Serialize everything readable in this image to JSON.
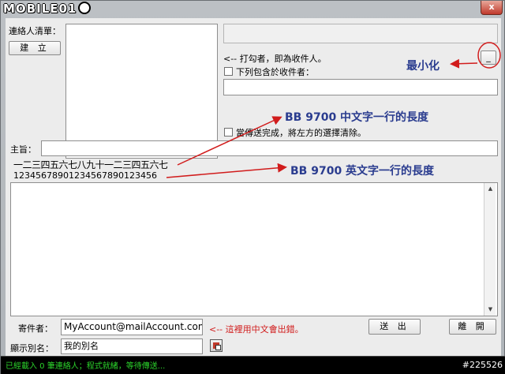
{
  "window": {
    "logo_text": "MOBILE01",
    "close_glyph": "x"
  },
  "contacts": {
    "label": "連絡人清單：",
    "create_button": "建 立"
  },
  "recipients": {
    "hint": "<-- 打勾者，即為收件人。",
    "include_label": "下列包含於收件者：",
    "minimize_button": "_",
    "clear_after_send_label": "當傳送完成，將左方的選擇清除。"
  },
  "subject": {
    "label": "主旨：",
    "value": ""
  },
  "sample_text": {
    "chinese_line": "一二三四五六七八九十一二三四五六七",
    "english_line": "12345678901234567890123456"
  },
  "annotations": {
    "minimize": "最小化",
    "chinese_width": "BB 9700  中文字一行的長度",
    "english_width": "BB 9700  英文字一行的長度",
    "sender_warning": "<-- 這裡用中文會出錯。"
  },
  "sender": {
    "label": "寄件者：",
    "value": "MyAccount@mailAccount.com",
    "alias_label": "顯示別名：",
    "alias_value": "我的別名"
  },
  "actions": {
    "send": "送 出",
    "leave": "離 開"
  },
  "status_bar": {
    "text": "已經載入 0 筆連絡人；程式就緒，等待傳送...",
    "watermark": "#225526"
  },
  "colors": {
    "annotation_blue": "#2a3c8f",
    "annotation_red": "#d11c1c",
    "status_green": "#2bd32b"
  }
}
